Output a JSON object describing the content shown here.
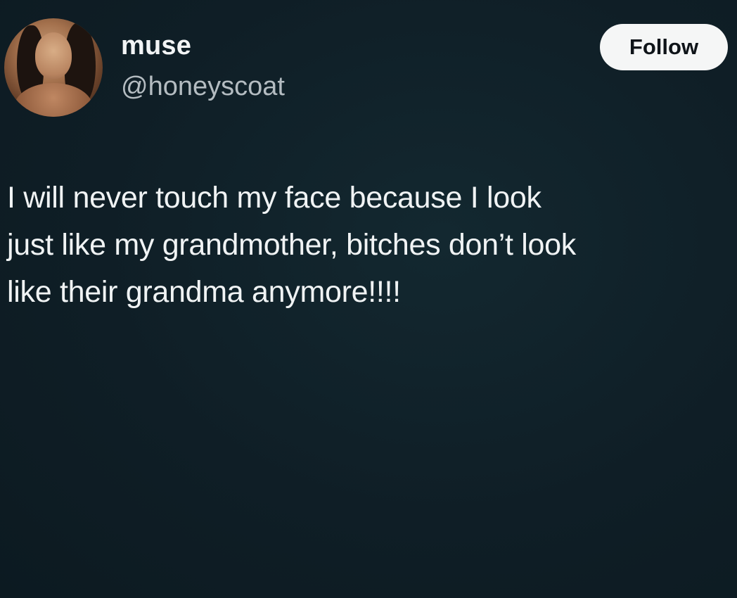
{
  "profile": {
    "display_name": "muse",
    "handle": "@honeyscoat",
    "avatar_icon": "profile-photo"
  },
  "actions": {
    "follow_label": "Follow"
  },
  "tweet": {
    "lines": [
      "I will never touch my face because I look",
      "just like my grandmother, bitches don’t look",
      "like their grandma anymore!!!!"
    ]
  },
  "colors": {
    "background": "#0f1f27",
    "text": "#f0f3f4",
    "handle": "#b4bcc1",
    "follow_button_bg": "#f5f6f6"
  }
}
